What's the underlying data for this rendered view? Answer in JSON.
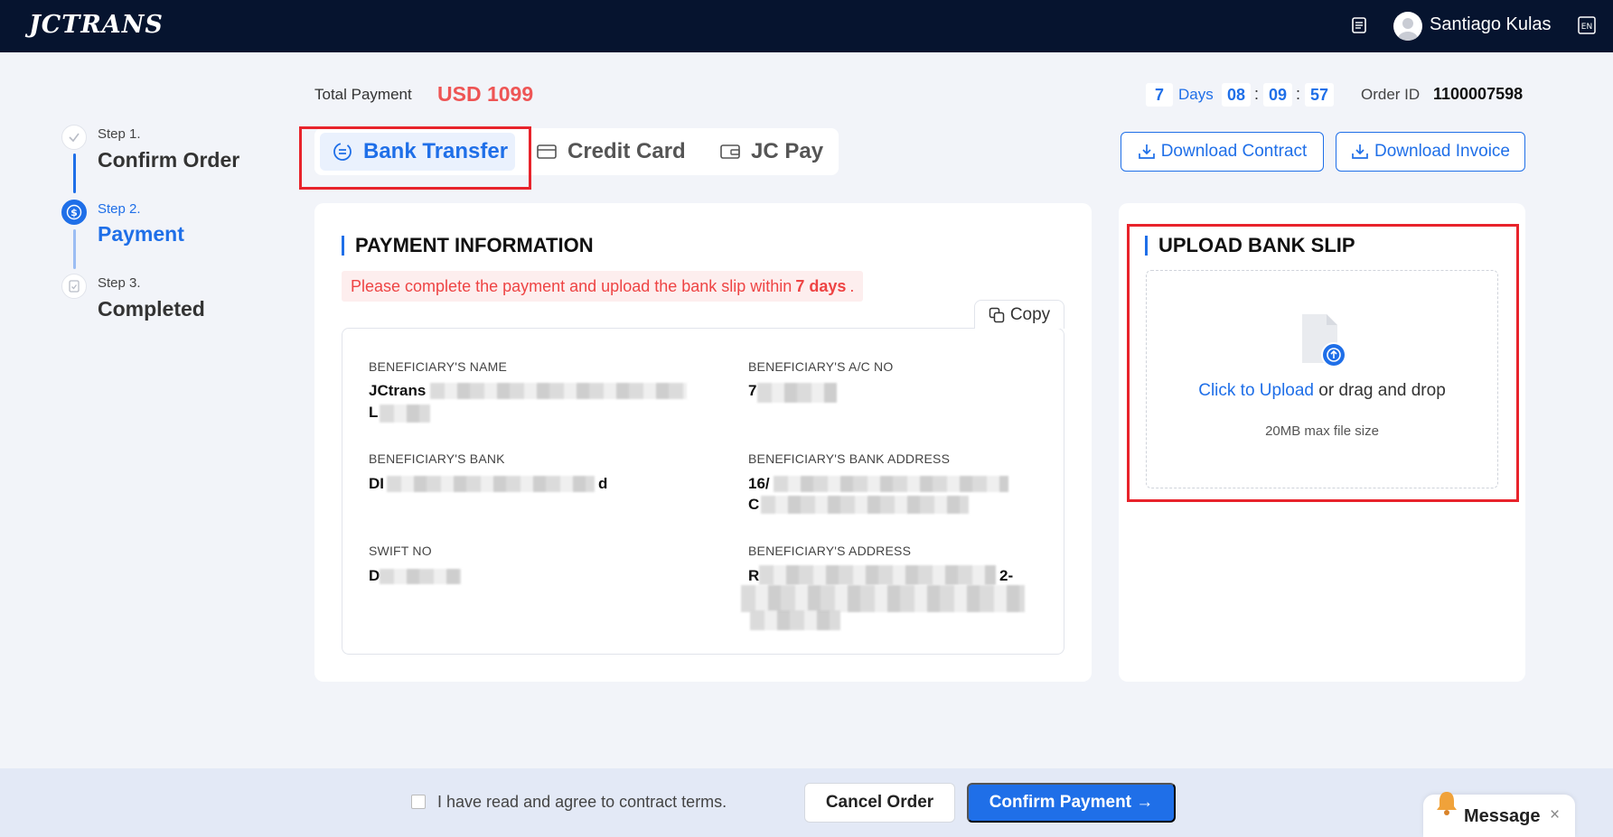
{
  "header": {
    "logo": "JCTRANS",
    "user_name": "Santiago Kulas",
    "lang": "EN"
  },
  "steps": [
    {
      "label": "Step 1.",
      "title": "Confirm Order",
      "state": "done"
    },
    {
      "label": "Step 2.",
      "title": "Payment",
      "state": "active"
    },
    {
      "label": "Step 3.",
      "title": "Completed",
      "state": "pending"
    }
  ],
  "payment": {
    "total_label": "Total Payment",
    "total_value": "USD 1099",
    "countdown": {
      "days": "7",
      "days_label": "Days",
      "hours": "08",
      "minutes": "09",
      "seconds": "57",
      "sep": ":"
    },
    "order_label": "Order ID",
    "order_id": "1100007598"
  },
  "tabs": [
    {
      "label": "Bank Transfer",
      "active": true
    },
    {
      "label": "Credit Card",
      "active": false
    },
    {
      "label": "JC Pay",
      "active": false
    }
  ],
  "downloads": {
    "contract": "Download Contract",
    "invoice": "Download Invoice"
  },
  "payment_info": {
    "title": "PAYMENT INFORMATION",
    "notice_pre": "Please complete the payment and upload the bank slip within",
    "notice_days": "7 days",
    "notice_post": ".",
    "copy": "Copy",
    "fields": {
      "beneficiary_name_label": "BENEFICIARY'S NAME",
      "beneficiary_name_value_1": "JCtrans",
      "beneficiary_name_value_2": "L",
      "ac_no_label": "BENEFICIARY'S A/C NO",
      "ac_no_value": "7",
      "bank_label": "BENEFICIARY'S BANK",
      "bank_value_1": "DI",
      "bank_value_2": "d",
      "bank_address_label": "BENEFICIARY'S BANK ADDRESS",
      "bank_address_value_1": "16/",
      "bank_address_value_2": "C",
      "swift_label": "SWIFT NO",
      "swift_value": "D",
      "address_label": "BENEFICIARY'S ADDRESS",
      "address_value_1": "R",
      "address_value_2": "2-"
    }
  },
  "upload": {
    "title": "UPLOAD BANK SLIP",
    "click_text": "Click to Upload",
    "drag_text": " or drag and drop",
    "hint": "20MB max file size"
  },
  "footer": {
    "agree_text": "I have read and agree to contract terms.",
    "cancel": "Cancel Order",
    "confirm": "Confirm Payment →",
    "message": "Message",
    "close": "×"
  },
  "colors": {
    "accent": "#1f6fe8",
    "header_bg": "#06142f",
    "price": "#ee5555",
    "highlight_box": "#e8232b"
  }
}
